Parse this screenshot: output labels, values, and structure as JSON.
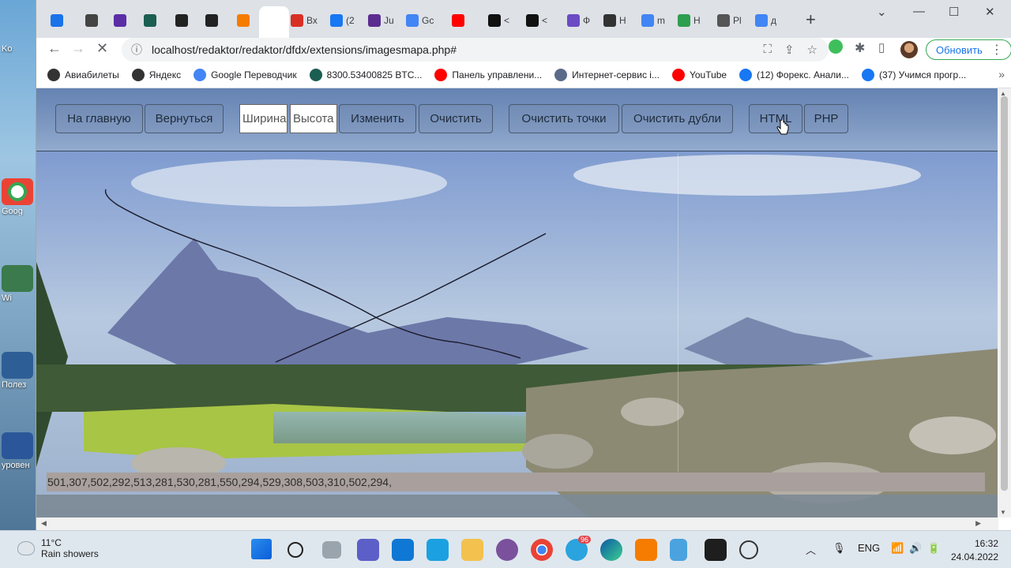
{
  "desktop": {
    "icons": [
      {
        "label": "Ko"
      },
      {
        "label": "Goog"
      },
      {
        "label": "Wi"
      },
      {
        "label": "Полез"
      },
      {
        "label": "уровен"
      }
    ]
  },
  "browser": {
    "tabs": [
      {
        "label": "",
        "icon": "gmail-icon",
        "color": "#1a73e8"
      },
      {
        "label": "",
        "icon": "slash-icon",
        "color": "#444"
      },
      {
        "label": "",
        "icon": "purple-app-icon",
        "color": "#5b2ea6"
      },
      {
        "label": "",
        "icon": "jetbrains-icon",
        "color": "#1b5e52"
      },
      {
        "label": "",
        "icon": "github-icon",
        "color": "#222"
      },
      {
        "label": "",
        "icon": "lf-icon",
        "color": "#222"
      },
      {
        "label": "",
        "icon": "xampp-icon",
        "color": "#f57c00"
      },
      {
        "label": "",
        "icon": "active-tab-icon",
        "color": "#fff"
      },
      {
        "label": "Вх",
        "icon": "gmail-icon",
        "color": "#d93025"
      },
      {
        "label": "(2",
        "icon": "facebook-icon",
        "color": "#1877f2"
      },
      {
        "label": "Ju",
        "icon": "jupyter-icon",
        "color": "#5c2d91"
      },
      {
        "label": "Gc",
        "icon": "translate-icon",
        "color": "#4285f4"
      },
      {
        "label": "",
        "icon": "youtube-icon",
        "color": "#ff0000"
      },
      {
        "label": "<",
        "icon": "m-icon",
        "color": "#111"
      },
      {
        "label": "<",
        "icon": "m-icon",
        "color": "#111"
      },
      {
        "label": "Ф",
        "icon": "b-icon",
        "color": "#6a4bc4"
      },
      {
        "label": "Н",
        "icon": "github-icon",
        "color": "#333"
      },
      {
        "label": "m",
        "icon": "google-icon",
        "color": "#4285f4"
      },
      {
        "label": "Н",
        "icon": "w-icon",
        "color": "#2e9e4f"
      },
      {
        "label": "Pl",
        "icon": "mail-icon",
        "color": "#555"
      },
      {
        "label": "д",
        "icon": "google-icon",
        "color": "#4285f4"
      }
    ],
    "new_tab": "+",
    "window_controls": {
      "collapse": "⌄",
      "minimize": "—",
      "maximize": "☐",
      "close": "✕"
    },
    "url": "localhost/redaktor/redaktor/dfdx/extensions/imagesmapa.php#",
    "update_label": "Обновить",
    "bookmarks": [
      {
        "label": "Авиабилеты",
        "color": "#333"
      },
      {
        "label": "Яндекс",
        "color": "#333"
      },
      {
        "label": "Google Переводчик",
        "color": "#4285f4"
      },
      {
        "label": "8300.53400825 BTC...",
        "color": "#1b5e52"
      },
      {
        "label": "Панель управлени...",
        "color": "#ff0000"
      },
      {
        "label": "Интернет-сервис i...",
        "color": "#5a6b8a"
      },
      {
        "label": "YouTube",
        "color": "#ff0000"
      },
      {
        "label": "(12) Форекс. Анали...",
        "color": "#1877f2"
      },
      {
        "label": "(37) Учимся прогр...",
        "color": "#1877f2"
      }
    ]
  },
  "page": {
    "buttons": {
      "home": "На главную",
      "back": "Вернуться",
      "width_placeholder": "Ширина",
      "height_placeholder": "Высота",
      "change": "Изменить",
      "clear": "Очистить",
      "clear_points": "Очистить точки",
      "clear_dups": "Очистить дубли",
      "html": "HTML",
      "php": "PHP"
    },
    "coords_text": "501,307,502,292,513,281,530,281,550,294,529,308,503,310,502,294,"
  },
  "taskbar": {
    "temperature": "11°C",
    "weather": "Rain showers",
    "language": "ENG",
    "time": "16:32",
    "date": "24.04.2022",
    "telegram_badge": "96"
  }
}
